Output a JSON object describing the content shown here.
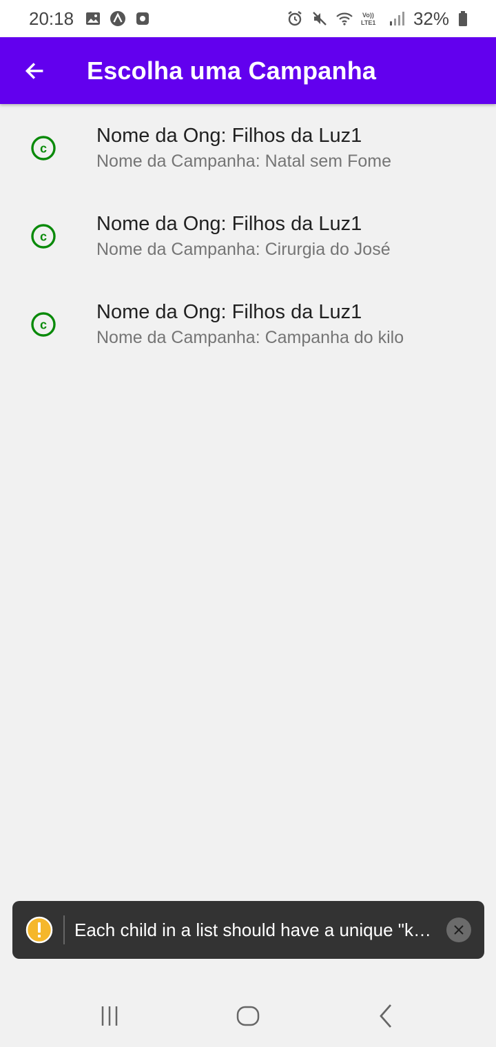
{
  "status_bar": {
    "time": "20:18",
    "battery": "32%",
    "left_icons": [
      "image-icon",
      "expo-icon",
      "record-icon"
    ],
    "right_icons": [
      "alarm-icon",
      "mute-icon",
      "wifi-icon",
      "volte-icon",
      "signal-icon",
      "battery-icon"
    ]
  },
  "app_bar": {
    "title": "Escolha uma Campanha",
    "back_icon": "arrow-left-icon",
    "color": "#6200ee"
  },
  "list": {
    "icon": "copyright-icon",
    "icon_color": "#0a8a0a",
    "items": [
      {
        "title": "Nome da Ong: Filhos da Luz1",
        "subtitle": "Nome da Campanha: Natal sem Fome"
      },
      {
        "title": "Nome da Ong: Filhos da Luz1",
        "subtitle": "Nome da Campanha: Cirurgia do José"
      },
      {
        "title": "Nome da Ong: Filhos da Luz1",
        "subtitle": "Nome da Campanha: Campanha do kilo"
      }
    ]
  },
  "toast": {
    "message": "Each child in a list should have a unique \"k…",
    "warn_icon": "warning-icon",
    "close_icon": "close-icon",
    "warn_color": "#f5b72b"
  },
  "nav_bar": {
    "buttons": [
      "recents-icon",
      "home-icon",
      "back-icon"
    ]
  }
}
